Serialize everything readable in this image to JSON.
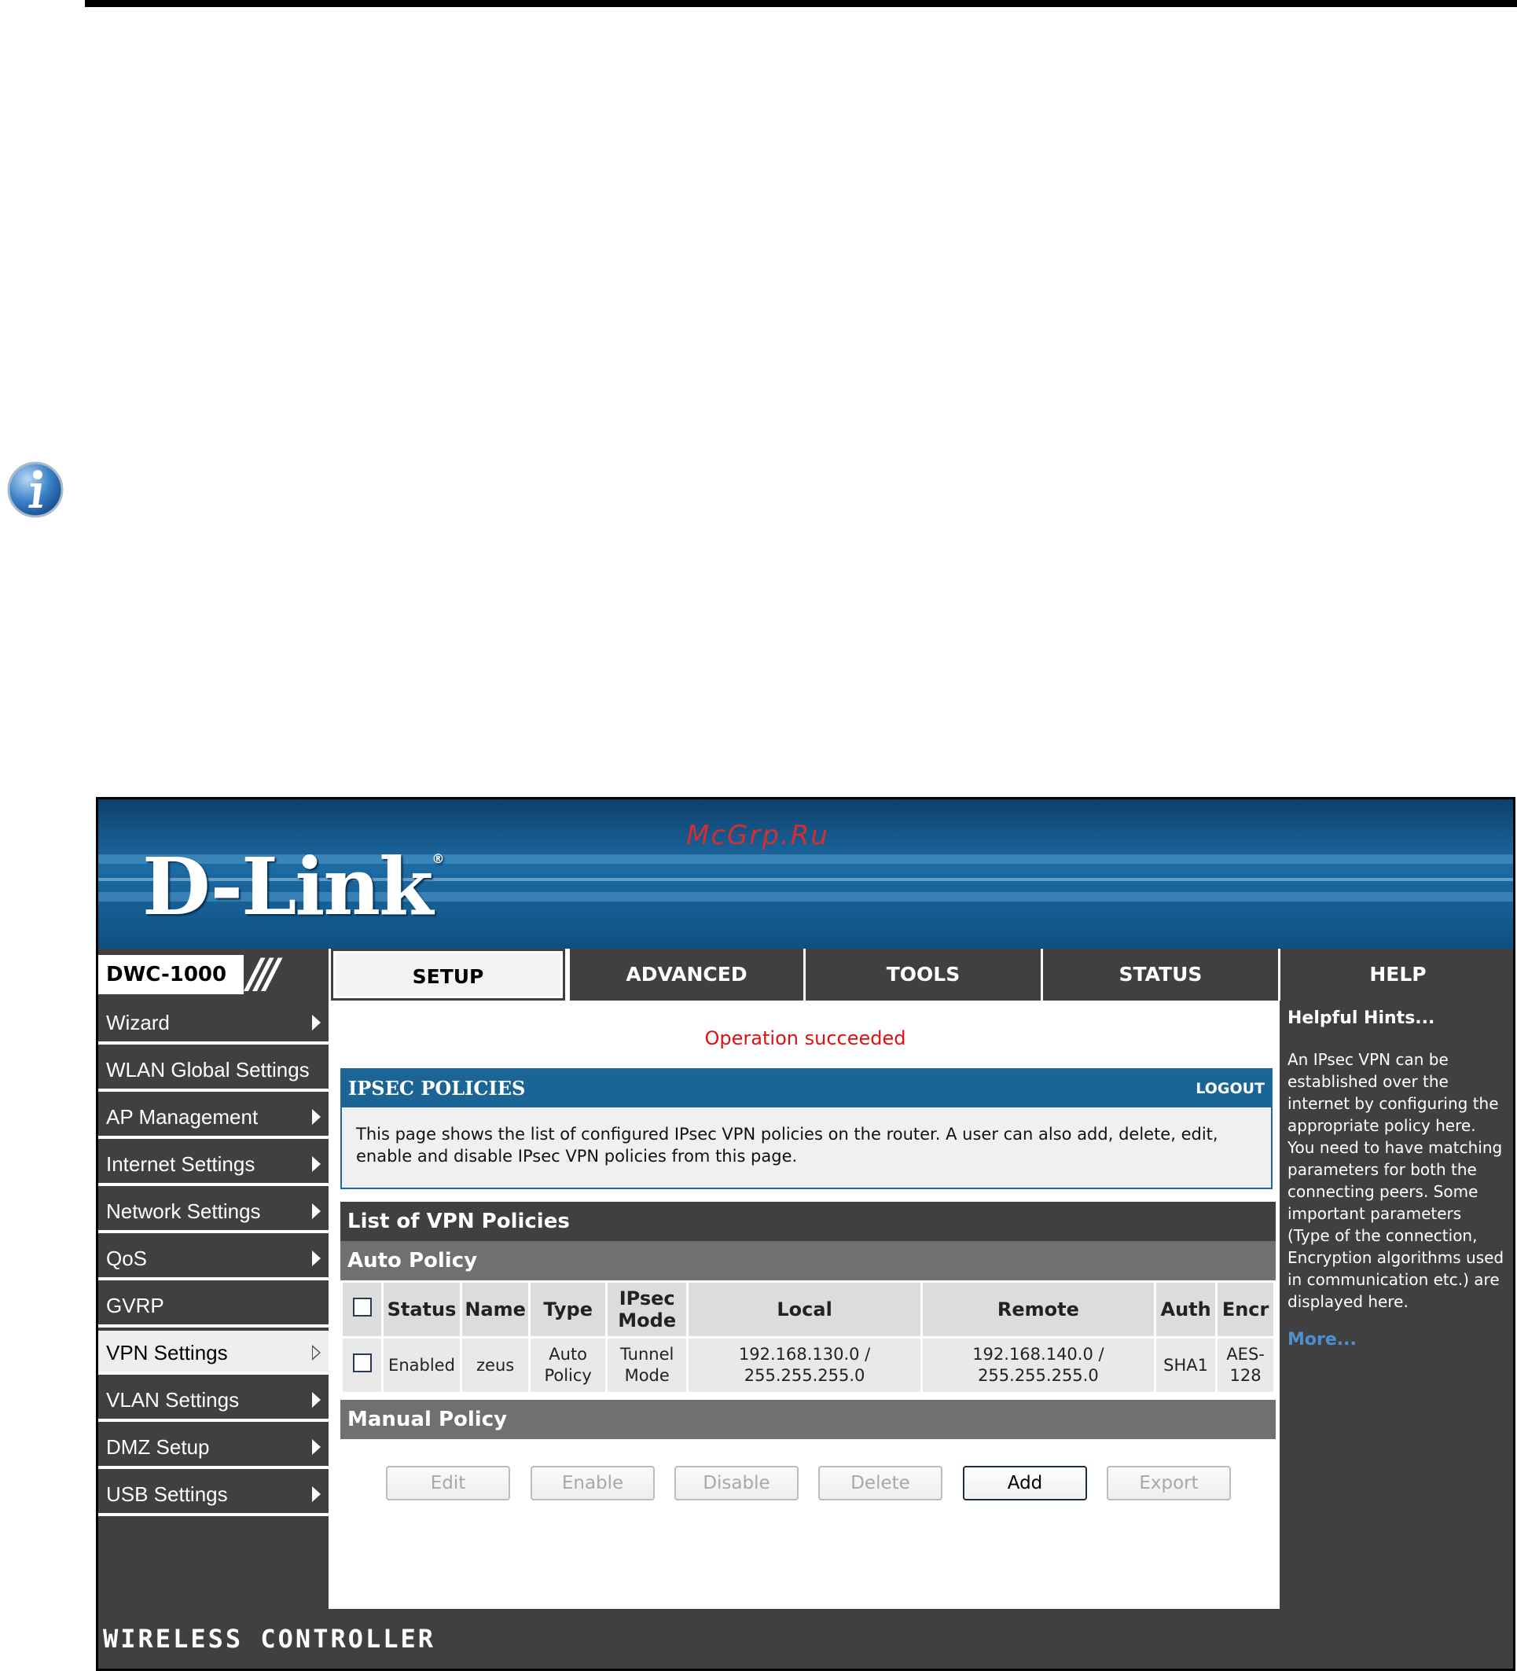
{
  "brand": {
    "logo": "D-Link",
    "registered": "®",
    "watermark": "McGrp.Ru",
    "model": "DWC-1000",
    "slashes": "///"
  },
  "tabs": [
    {
      "label": "SETUP",
      "active": true
    },
    {
      "label": "ADVANCED",
      "active": false
    },
    {
      "label": "TOOLS",
      "active": false
    },
    {
      "label": "STATUS",
      "active": false
    },
    {
      "label": "HELP",
      "active": false
    }
  ],
  "sidebar": {
    "items": [
      {
        "label": "Wizard",
        "arrow": true
      },
      {
        "label": "WLAN Global Settings",
        "arrow": false
      },
      {
        "label": "AP Management",
        "arrow": true
      },
      {
        "label": "Internet Settings",
        "arrow": true
      },
      {
        "label": "Network Settings",
        "arrow": true
      },
      {
        "label": "QoS",
        "arrow": true
      },
      {
        "label": "GVRP",
        "arrow": false
      },
      {
        "label": "VPN Settings",
        "arrow": true,
        "active": true
      },
      {
        "label": "VLAN Settings",
        "arrow": true
      },
      {
        "label": "DMZ Setup",
        "arrow": true
      },
      {
        "label": "USB Settings",
        "arrow": true
      }
    ]
  },
  "main": {
    "status_message": "Operation succeeded",
    "panel_title": "IPSEC POLICIES",
    "logout": "LOGOUT",
    "description": "This page shows the list of configured IPsec VPN policies on the router. A user can also add, delete, edit, enable and disable IPsec VPN policies from this page.",
    "list_title": "List of VPN Policies",
    "auto_policy_title": "Auto Policy",
    "manual_policy_title": "Manual Policy",
    "columns": [
      "Status",
      "Name",
      "Type",
      "IPsec Mode",
      "Local",
      "Remote",
      "Auth",
      "Encr"
    ],
    "rows": [
      {
        "status": "Enabled",
        "name": "zeus",
        "type": "Auto Policy",
        "mode": "Tunnel Mode",
        "local": "192.168.130.0 / 255.255.255.0",
        "remote": "192.168.140.0 / 255.255.255.0",
        "auth": "SHA1",
        "encr": "AES-128"
      }
    ],
    "buttons": {
      "edit": "Edit",
      "enable": "Enable",
      "disable": "Disable",
      "delete": "Delete",
      "add": "Add",
      "export": "Export"
    }
  },
  "help": {
    "title": "Helpful Hints...",
    "text": "An IPsec VPN can be established over the internet by configuring the appropriate policy here. You need to have matching parameters for both the connecting peers. Some important parameters (Type of the connection, Encryption algorithms used in communication etc.) are displayed here.",
    "more": "More..."
  },
  "footer": {
    "label": "WIRELESS CONTROLLER"
  },
  "colors": {
    "accent": "#1a6496",
    "dark": "#404040",
    "status_red": "#e01010",
    "link": "#4f8fd0"
  }
}
